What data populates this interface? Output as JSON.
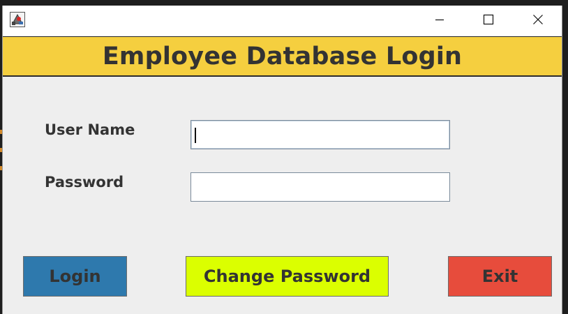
{
  "window": {
    "app_icon": "java-app-icon",
    "controls": [
      "minimize-icon",
      "maximize-icon",
      "close-icon"
    ]
  },
  "header": {
    "title": "Employee Database Login",
    "background": "#f5cf3f"
  },
  "form": {
    "username": {
      "label": "User Name",
      "value": ""
    },
    "password": {
      "label": "Password",
      "value": ""
    }
  },
  "buttons": {
    "login": {
      "label": "Login",
      "color": "#2e79ad"
    },
    "change_password": {
      "label": "Change Password",
      "color": "#dbff00"
    },
    "exit": {
      "label": "Exit",
      "color": "#e74c3c"
    }
  }
}
